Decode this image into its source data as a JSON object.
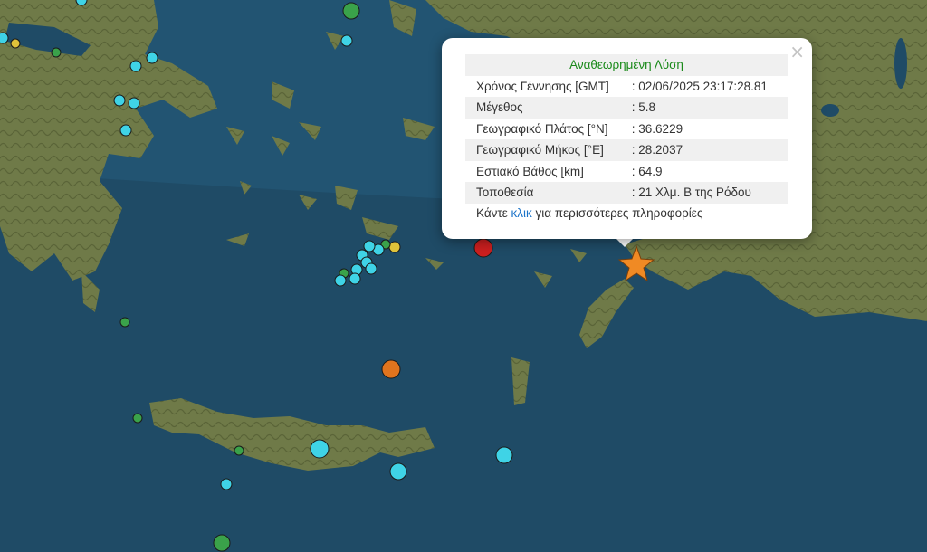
{
  "popup": {
    "title": "Αναθεωρημένη Λύση",
    "close_glyph": "×",
    "rows": [
      {
        "label": "Χρόνος Γέννησης [GMT]",
        "value": ": 02/06/2025 23:17:28.81"
      },
      {
        "label": "Μέγεθος",
        "value": ": 5.8"
      },
      {
        "label": "Γεωγραφικό Πλάτος [°N]",
        "value": ": 36.6229"
      },
      {
        "label": "Γεωγραφικό Μήκος [°E]",
        "value": ": 28.2037"
      },
      {
        "label": "Εστιακό Βάθος [km]",
        "value": ": 64.9"
      },
      {
        "label": "Τοποθεσία",
        "value": ": 21 Χλμ. Β της Ρόδου"
      }
    ],
    "more_prefix": "Κάντε ",
    "more_link": "κλικ",
    "more_suffix": " για περισσότερες πληροφορίες"
  },
  "colors": {
    "sea": "#1f4b66",
    "land": "#6f7a48",
    "mainshock_star": "#f08a24",
    "cyan_event": "#3fd3e6",
    "green_event": "#3aa24a",
    "yellow_event": "#e0c33a",
    "orange_event": "#e0741e",
    "red_event": "#cc1f1f",
    "title_green": "#1a8a1a",
    "link_blue": "#1a73c8"
  },
  "icons": {
    "mainshock": "star-icon",
    "close": "close-icon"
  }
}
